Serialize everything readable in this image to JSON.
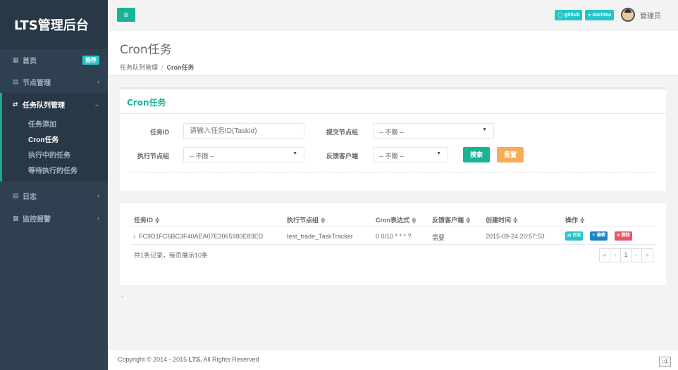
{
  "brand": "LTS管理后台",
  "sidebar": {
    "home": {
      "label": "首页",
      "badge": "推荐"
    },
    "nodes": {
      "label": "节点管理"
    },
    "queue": {
      "label": "任务队列管理",
      "children": [
        {
          "label": "任务添加"
        },
        {
          "label": "Cron任务"
        },
        {
          "label": "执行中的任务"
        },
        {
          "label": "等待执行的任务"
        }
      ]
    },
    "logs": {
      "label": "日志"
    },
    "monitor": {
      "label": "监控报警"
    }
  },
  "topbar": {
    "menu_icon": "≡",
    "github": "github",
    "oschina": "oschina",
    "admin": "管理员"
  },
  "page": {
    "title": "Cron任务",
    "breadcrumb": [
      "任务队列管理",
      "Cron任务"
    ]
  },
  "search": {
    "panel_title": "Cron任务",
    "task_id_label": "任务ID",
    "task_id_placeholder": "请输入任务ID(TaskId)",
    "submit_group_label": "提交节点组",
    "submit_group_value": "-- 不限 --",
    "exec_group_label": "执行节点组",
    "exec_group_value": "-- 不限 --",
    "feedback_label": "反馈客户端",
    "feedback_value": "-- 不限 --",
    "search_btn": "搜索",
    "reset_btn": "重置"
  },
  "table": {
    "headers": [
      "任务ID ≑",
      "执行节点组 ≑",
      "Cron表达式 ≑",
      "反馈客户端 ≑",
      "创建时间 ≑",
      "操作 ≑"
    ],
    "rows": [
      {
        "expand": "›",
        "task_id": "FC9D1FC6BC3F40AEA07E3065980E83ED",
        "exec_group": "test_trade_TaskTracker",
        "cron": "0 0/10 * * * ?",
        "feedback": "需要",
        "created": "2015-09-24 20:57:53",
        "ops": [
          "日志",
          "编辑",
          "删除"
        ]
      }
    ],
    "summary": "共1条记录，每页展示10条",
    "pager": [
      "«",
      "‹",
      "1",
      "›",
      "»"
    ]
  },
  "misc": {
    "backtick": "`"
  },
  "footer": {
    "prefix": "Copyright © 2014 - 2015 ",
    "brand": "LTS.",
    "suffix": " All Rights Reserved",
    "corner": "::1"
  }
}
